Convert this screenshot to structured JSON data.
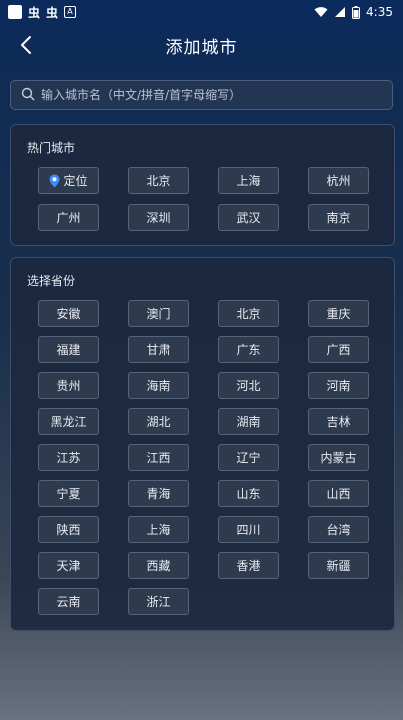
{
  "status_bar": {
    "time": "4:35",
    "app_glyph_1": "虫",
    "app_glyph_2": "虫",
    "a_badge": "A"
  },
  "nav": {
    "title": "添加城市"
  },
  "search": {
    "placeholder": "输入城市名（中文/拼音/首字母缩写）",
    "value": ""
  },
  "hot_cities": {
    "title": "热门城市",
    "items": [
      "定位",
      "北京",
      "上海",
      "杭州",
      "广州",
      "深圳",
      "武汉",
      "南京"
    ]
  },
  "provinces": {
    "title": "选择省份",
    "items": [
      "安徽",
      "澳门",
      "北京",
      "重庆",
      "福建",
      "甘肃",
      "广东",
      "广西",
      "贵州",
      "海南",
      "河北",
      "河南",
      "黑龙江",
      "湖北",
      "湖南",
      "吉林",
      "江苏",
      "江西",
      "辽宁",
      "内蒙古",
      "宁夏",
      "青海",
      "山东",
      "山西",
      "陕西",
      "上海",
      "四川",
      "台湾",
      "天津",
      "西藏",
      "香港",
      "新疆",
      "云南",
      "浙江"
    ]
  },
  "colors": {
    "accent": "#3d8bff"
  }
}
